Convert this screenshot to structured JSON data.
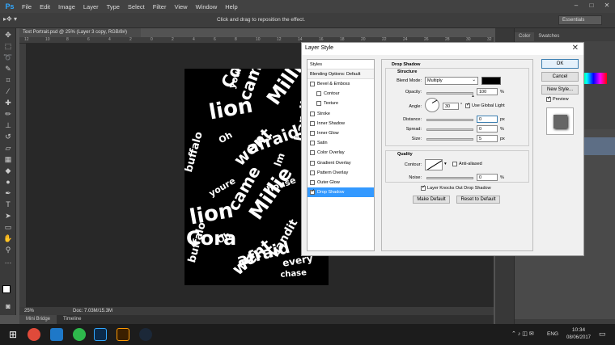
{
  "menubar": {
    "logo": "Ps",
    "items": [
      "File",
      "Edit",
      "Image",
      "Layer",
      "Type",
      "Select",
      "Filter",
      "View",
      "Window",
      "Help"
    ],
    "window_controls": [
      "–",
      "□",
      "✕"
    ]
  },
  "options": {
    "hint": "Click and drag to reposition the effect.",
    "workspace": "Essentials"
  },
  "document": {
    "tab_title": "Text Portrait.psd @ 25% (Layer 3 copy, RGB/8#)",
    "ruler_marks": [
      "12",
      "10",
      "8",
      "6",
      "4",
      "2",
      "0",
      "2",
      "4",
      "6",
      "8",
      "10",
      "12",
      "14",
      "16",
      "18",
      "20",
      "22",
      "24",
      "26",
      "28",
      "30",
      "32"
    ],
    "zoom": "25%",
    "doc_size": "Doc: 7.03M/15.3M",
    "words": [
      "Cora",
      "lion",
      "came",
      "Millie",
      "afraid",
      "went",
      "bandit",
      "buffalo",
      "Oh",
      "youre",
      "lm",
      "house",
      "every",
      "chase",
      "lion",
      "Cora",
      "came",
      "Millie",
      "afraid",
      "went",
      "buffalo",
      "bandit",
      "youre",
      "Oh"
    ]
  },
  "bottom_tabs": [
    "Mini Bridge",
    "Timeline"
  ],
  "panels": {
    "tabs": [
      "Color",
      "Swatches"
    ]
  },
  "dialog": {
    "title": "Layer Style",
    "close": "✕",
    "styles_header": "Styles",
    "blending_options": "Blending Options: Default",
    "style_items": [
      {
        "label": "Bevel & Emboss",
        "checked": false,
        "indent": false
      },
      {
        "label": "Contour",
        "checked": false,
        "indent": true
      },
      {
        "label": "Texture",
        "checked": false,
        "indent": true
      },
      {
        "label": "Stroke",
        "checked": false,
        "indent": false
      },
      {
        "label": "Inner Shadow",
        "checked": false,
        "indent": false
      },
      {
        "label": "Inner Glow",
        "checked": false,
        "indent": false
      },
      {
        "label": "Satin",
        "checked": false,
        "indent": false
      },
      {
        "label": "Color Overlay",
        "checked": false,
        "indent": false
      },
      {
        "label": "Gradient Overlay",
        "checked": false,
        "indent": false
      },
      {
        "label": "Pattern Overlay",
        "checked": false,
        "indent": false
      },
      {
        "label": "Outer Glow",
        "checked": false,
        "indent": false
      },
      {
        "label": "Drop Shadow",
        "checked": true,
        "indent": false,
        "selected": true
      }
    ],
    "section_title": "Drop Shadow",
    "structure_title": "Structure",
    "blend_mode_label": "Blend Mode:",
    "blend_mode": "Multiply",
    "shadow_color": "#000000",
    "opacity_label": "Opacity:",
    "opacity": "100",
    "opacity_fraction": 1.0,
    "angle_label": "Angle:",
    "angle": "30",
    "angle_unit": "°",
    "global_light_label": "Use Global Light",
    "distance_label": "Distance:",
    "distance": "0",
    "spread_label": "Spread:",
    "spread": "0",
    "size_label": "Size:",
    "size": "5",
    "quality_title": "Quality",
    "contour_label": "Contour:",
    "anti_aliased_label": "Anti-aliased",
    "noise_label": "Noise:",
    "noise": "0",
    "knocks_out_label": "Layer Knocks Out Drop Shadow",
    "make_default": "Make Default",
    "reset_default": "Reset to Default",
    "unit_percent": "%",
    "unit_px": "px",
    "ok": "OK",
    "cancel": "Cancel",
    "new_style": "New Style...",
    "preview_label": "Preview"
  },
  "taskbar": {
    "language": "ENG",
    "time": "10:34",
    "date": "08/06/2017"
  }
}
